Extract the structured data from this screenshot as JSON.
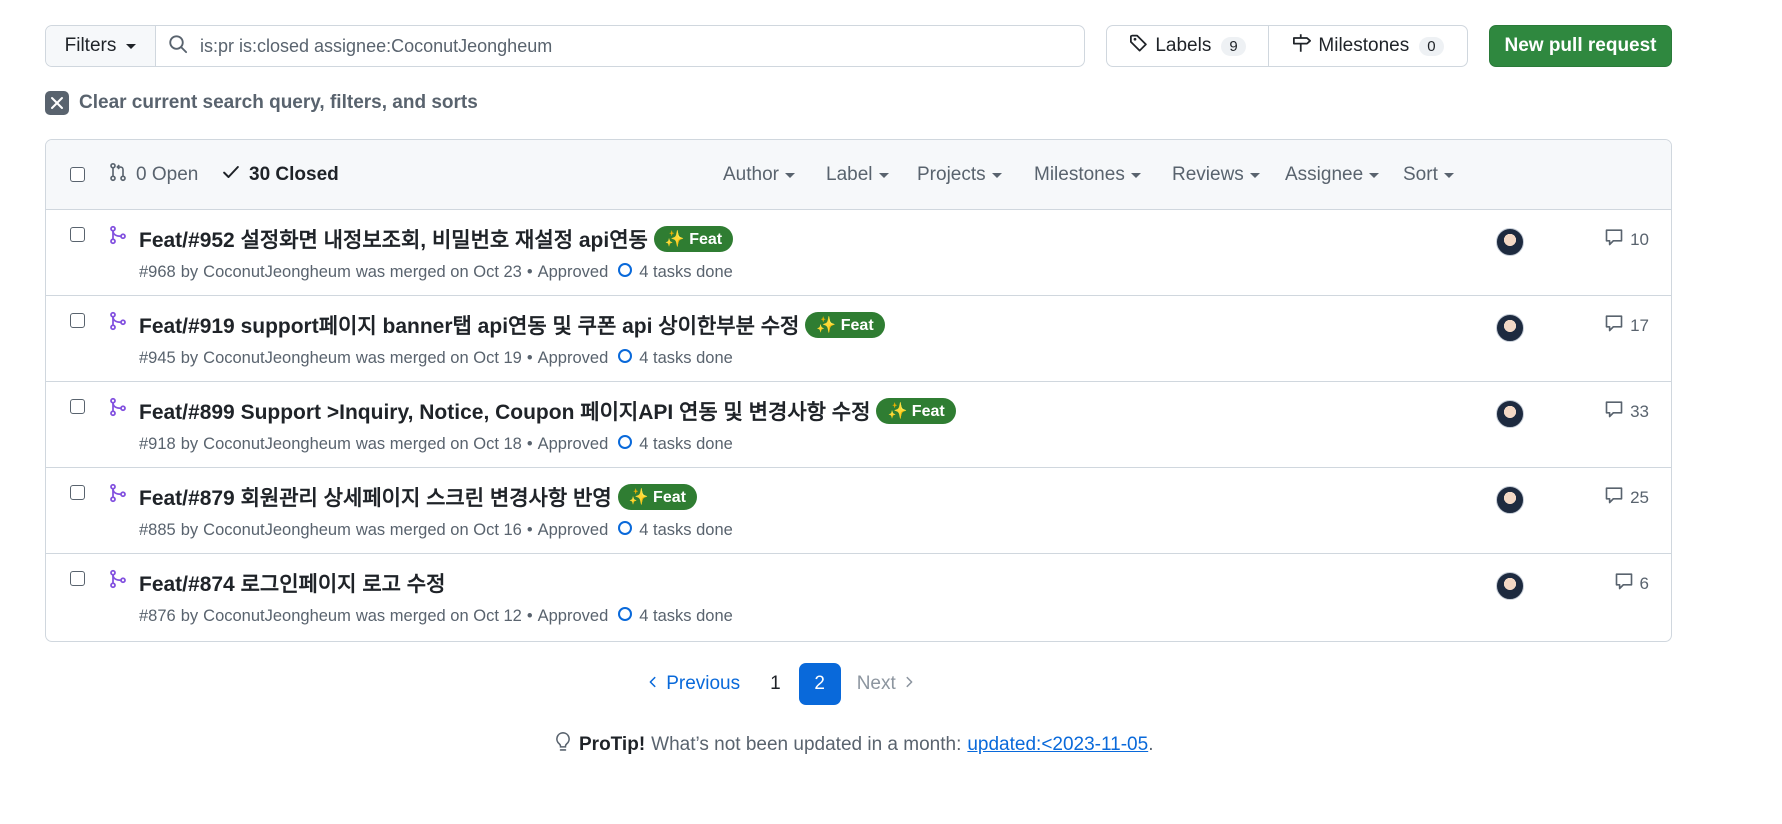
{
  "toolbar": {
    "filters_label": "Filters",
    "search_value": "is:pr is:closed assignee:CoconutJeongheum",
    "labels_label": "Labels",
    "labels_count": "9",
    "milestones_label": "Milestones",
    "milestones_count": "0",
    "new_pr_label": "New pull request"
  },
  "clear_text": "Clear current search query, filters, and sorts",
  "header": {
    "open_label": "0 Open",
    "closed_label": "30 Closed",
    "filters": [
      "Author",
      "Label",
      "Projects",
      "Milestones",
      "Reviews",
      "Assignee",
      "Sort"
    ]
  },
  "pulls": [
    {
      "title": "Feat/#952 설정화면 내정보조회, 비밀번호 재설정 api연동",
      "label": "✨ Feat",
      "number": "#968",
      "by": "by",
      "author": "CoconutJeongheum",
      "merged_text": "was merged on Oct 23",
      "review": "Approved",
      "tasks": "4 tasks done",
      "comments": "10"
    },
    {
      "title": "Feat/#919 support페이지 banner탭 api연동 및 쿠폰 api 상이한부분 수정",
      "label": "✨ Feat",
      "number": "#945",
      "by": "by",
      "author": "CoconutJeongheum",
      "merged_text": "was merged on Oct 19",
      "review": "Approved",
      "tasks": "4 tasks done",
      "comments": "17"
    },
    {
      "title": "Feat/#899 Support >Inquiry, Notice, Coupon 페이지API 연동 및 변경사항 수정",
      "label": "✨ Feat",
      "number": "#918",
      "by": "by",
      "author": "CoconutJeongheum",
      "merged_text": "was merged on Oct 18",
      "review": "Approved",
      "tasks": "4 tasks done",
      "comments": "33"
    },
    {
      "title": "Feat/#879 회원관리 상세페이지 스크린 변경사항 반영",
      "label": "✨ Feat",
      "number": "#885",
      "by": "by",
      "author": "CoconutJeongheum",
      "merged_text": "was merged on Oct 16",
      "review": "Approved",
      "tasks": "4 tasks done",
      "comments": "25"
    },
    {
      "title": "Feat/#874 로그인페이지 로고 수정",
      "label": "",
      "number": "#876",
      "by": "by",
      "author": "CoconutJeongheum",
      "merged_text": "was merged on Oct 12",
      "review": "Approved",
      "tasks": "4 tasks done",
      "comments": "6"
    }
  ],
  "pagination": {
    "previous": "Previous",
    "page1": "1",
    "page2": "2",
    "next": "Next"
  },
  "protip": {
    "label": "ProTip!",
    "text": "What’s not been updated in a month:",
    "link": "updated:<2023-11-05",
    "period": "."
  },
  "colors": {
    "primary_button": "#2f883f",
    "label_feat": "#2f7d32",
    "merged_icon": "#8250df",
    "link": "#0969da",
    "task_ring": "#0969da"
  }
}
